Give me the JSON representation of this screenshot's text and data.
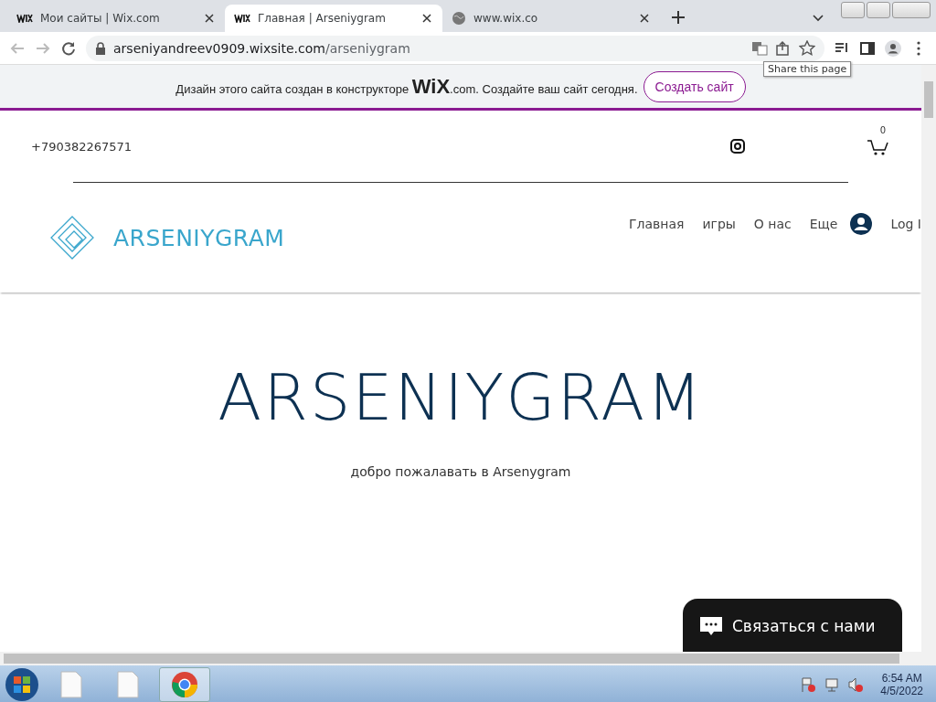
{
  "browser": {
    "tabs": [
      {
        "title": "Мои сайты | Wix.com",
        "kind": "wix",
        "selected": false
      },
      {
        "title": "Главная | Arseniygram",
        "kind": "wix",
        "selected": true
      },
      {
        "title": "www.wix.co",
        "kind": "globe",
        "selected": false
      }
    ],
    "url_domain": "arseniyandreev0909.wixsite.com",
    "url_path": "/arseniygram",
    "tooltip": "Share this page"
  },
  "banner": {
    "text": "Дизайн этого сайта создан в конструкторе **WiX**.com. Создайте ваш сайт сегодня.",
    "button": "Создать сайт"
  },
  "site": {
    "phone": "+790382267571",
    "cart_count": "0",
    "logo_text": "ARSENIYGRAM",
    "nav": [
      {
        "label": "Главная"
      },
      {
        "label": "игры"
      },
      {
        "label": "О нас"
      },
      {
        "label": "Еще"
      }
    ],
    "login": "Log I",
    "hero_title": "ARSENIYGRAM",
    "hero_subtitle": "добро пожалавать в Arsenygram",
    "chat_button": "Связаться с нами"
  },
  "taskbar": {
    "apps": [
      {
        "kind": "file",
        "selected": false
      },
      {
        "kind": "file",
        "selected": false
      },
      {
        "kind": "chrome",
        "selected": true
      }
    ],
    "time": "6:54 AM",
    "date": "4/5/2022"
  }
}
